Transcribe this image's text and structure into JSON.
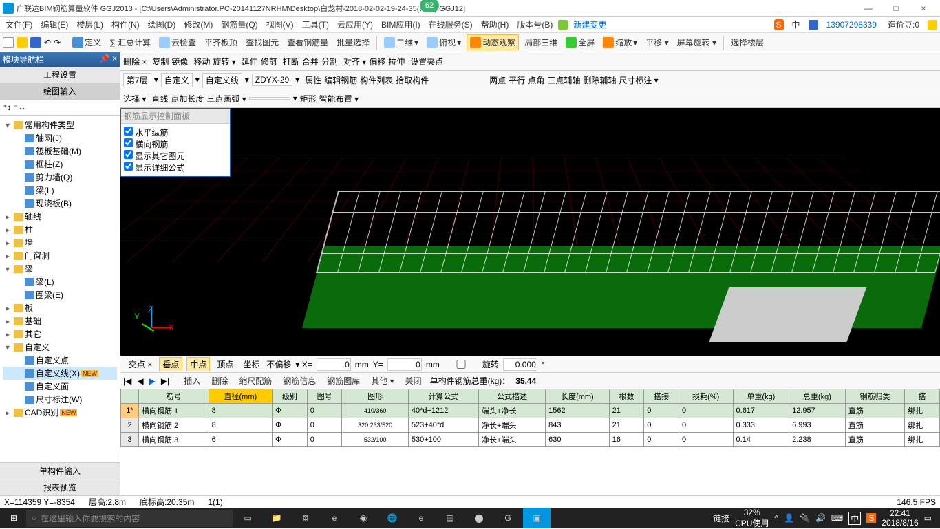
{
  "title": "广联达BIM钢筋算量软件 GGJ2013 - [C:\\Users\\Administrator.PC-20141127NRHM\\Desktop\\白龙村-2018-02-02-19-24-35(……).GGJ12]",
  "badge": "62",
  "window_buttons": [
    "—",
    "□",
    "×"
  ],
  "menus": [
    "文件(F)",
    "编辑(E)",
    "楼层(L)",
    "构件(N)",
    "绘图(D)",
    "修改(M)",
    "钢筋量(Q)",
    "视图(V)",
    "工具(T)",
    "云应用(Y)",
    "BIM应用(I)",
    "在线服务(S)",
    "帮助(H)",
    "版本号(B)"
  ],
  "menu_right": {
    "new": "新建变更",
    "ime": "中",
    "user": "13907298339",
    "coin": "造价豆:0"
  },
  "toolbar1": [
    "定义",
    "∑ 汇总计算",
    "云检查",
    "平齐板顶",
    "查找图元",
    "查看钢筋量",
    "批量选择",
    "二维",
    "俯视",
    "动态观察",
    "局部三维",
    "全屏",
    "缩放",
    "平移",
    "屏幕旋转",
    "选择楼层"
  ],
  "toolbar1_active": "动态观察",
  "toolbar2": [
    "删除",
    "复制",
    "镜像",
    "移动",
    "旋转",
    "延伸",
    "修剪",
    "打断",
    "合并",
    "分割",
    "对齐",
    "偏移",
    "拉伸",
    "设置夹点"
  ],
  "toolbar3": {
    "floor": "第7层",
    "type": "自定义",
    "line": "自定义线",
    "code": "ZDYX-29",
    "buttons": [
      "属性",
      "编辑钢筋",
      "构件列表",
      "拾取构件",
      "两点",
      "平行",
      "点角",
      "三点辅轴",
      "删除辅轴",
      "尺寸标注"
    ],
    "active": "编辑钢筋"
  },
  "toolbar4": [
    "选择",
    "直线",
    "点加长度",
    "三点画弧",
    "矩形",
    "智能布置"
  ],
  "sidebar": {
    "header": "模块导航栏",
    "tabs": [
      "工程设置",
      "绘图输入"
    ],
    "tree": [
      {
        "l": 1,
        "exp": "▾",
        "label": "常用构件类型",
        "children": [
          {
            "l": 2,
            "label": "轴网(J)"
          },
          {
            "l": 2,
            "label": "筏板基础(M)"
          },
          {
            "l": 2,
            "label": "框柱(Z)"
          },
          {
            "l": 2,
            "label": "剪力墙(Q)"
          },
          {
            "l": 2,
            "label": "梁(L)"
          },
          {
            "l": 2,
            "label": "现浇板(B)"
          }
        ]
      },
      {
        "l": 1,
        "exp": "▸",
        "label": "轴线"
      },
      {
        "l": 1,
        "exp": "▸",
        "label": "柱"
      },
      {
        "l": 1,
        "exp": "▸",
        "label": "墙"
      },
      {
        "l": 1,
        "exp": "▸",
        "label": "门窗洞"
      },
      {
        "l": 1,
        "exp": "▾",
        "label": "梁",
        "children": [
          {
            "l": 2,
            "label": "梁(L)"
          },
          {
            "l": 2,
            "label": "圈梁(E)"
          }
        ]
      },
      {
        "l": 1,
        "exp": "▸",
        "label": "板"
      },
      {
        "l": 1,
        "exp": "▸",
        "label": "基础"
      },
      {
        "l": 1,
        "exp": "▸",
        "label": "其它"
      },
      {
        "l": 1,
        "exp": "▾",
        "label": "自定义",
        "children": [
          {
            "l": 2,
            "label": "自定义点"
          },
          {
            "l": 2,
            "label": "自定义线(X)",
            "sel": true,
            "new": true
          },
          {
            "l": 2,
            "label": "自定义面"
          },
          {
            "l": 2,
            "label": "尺寸标注(W)"
          }
        ]
      },
      {
        "l": 1,
        "exp": "▸",
        "label": "CAD识别",
        "new": true
      }
    ],
    "footer": [
      "单构件输入",
      "报表预览"
    ]
  },
  "floating": {
    "title": "钢筋显示控制面板",
    "items": [
      "水平纵筋",
      "横向钢筋",
      "显示其它图元",
      "显示详细公式"
    ]
  },
  "snapbar": {
    "items": [
      "交点",
      "垂点",
      "中点",
      "顶点",
      "坐标"
    ],
    "active": [
      "垂点",
      "中点"
    ],
    "offset": "不偏移",
    "x": "0",
    "y": "0",
    "unit": "mm",
    "rot": "旋转",
    "rotval": "0.000"
  },
  "infobar": {
    "nav": [
      "|◀",
      "◀",
      "▶",
      "▶|"
    ],
    "buttons": [
      "插入",
      "删除",
      "缩尺配筋",
      "钢筋信息",
      "钢筋图库",
      "其他",
      "关闭"
    ],
    "total_label": "单构件钢筋总重(kg)：",
    "total": "35.44"
  },
  "table": {
    "headers": [
      "",
      "筋号",
      "直径(mm)",
      "级别",
      "图号",
      "图形",
      "计算公式",
      "公式描述",
      "长度(mm)",
      "根数",
      "搭接",
      "损耗(%)",
      "单重(kg)",
      "总重(kg)",
      "钢筋归类",
      "搭"
    ],
    "hl_col": 2,
    "rows": [
      {
        "n": "1*",
        "sel": true,
        "c": [
          "横向钢筋.1",
          "8",
          "Φ",
          "0",
          "",
          "40*d+1212",
          "端头+净长",
          "1562",
          "21",
          "0",
          "0",
          "0.617",
          "12.957",
          "直筋",
          "绑扎"
        ]
      },
      {
        "n": "2",
        "c": [
          "横向钢筋.2",
          "8",
          "Φ",
          "0",
          "",
          "523+40*d",
          "净长+端头",
          "843",
          "21",
          "0",
          "0",
          "0.333",
          "6.993",
          "直筋",
          "绑扎"
        ]
      },
      {
        "n": "3",
        "c": [
          "横向钢筋.3",
          "6",
          "Φ",
          "0",
          "",
          "530+100",
          "净长+端头",
          "630",
          "16",
          "0",
          "0",
          "0.14",
          "2.238",
          "直筋",
          "绑扎"
        ]
      }
    ],
    "shapes": [
      "410/360",
      "320 233/520",
      "532/100"
    ]
  },
  "status": {
    "coord": "X=114359 Y=-8354",
    "floor": "层高:2.8m",
    "base": "底标高:20.35m",
    "sel": "1(1)",
    "fps": "146.5 FPS"
  },
  "taskbar": {
    "search": "在这里输入你要搜索的内容",
    "link": "链接",
    "cpu": "32%",
    "cpu2": "CPU使用",
    "time": "22:41",
    "date": "2018/8/16",
    "ime": "中"
  }
}
